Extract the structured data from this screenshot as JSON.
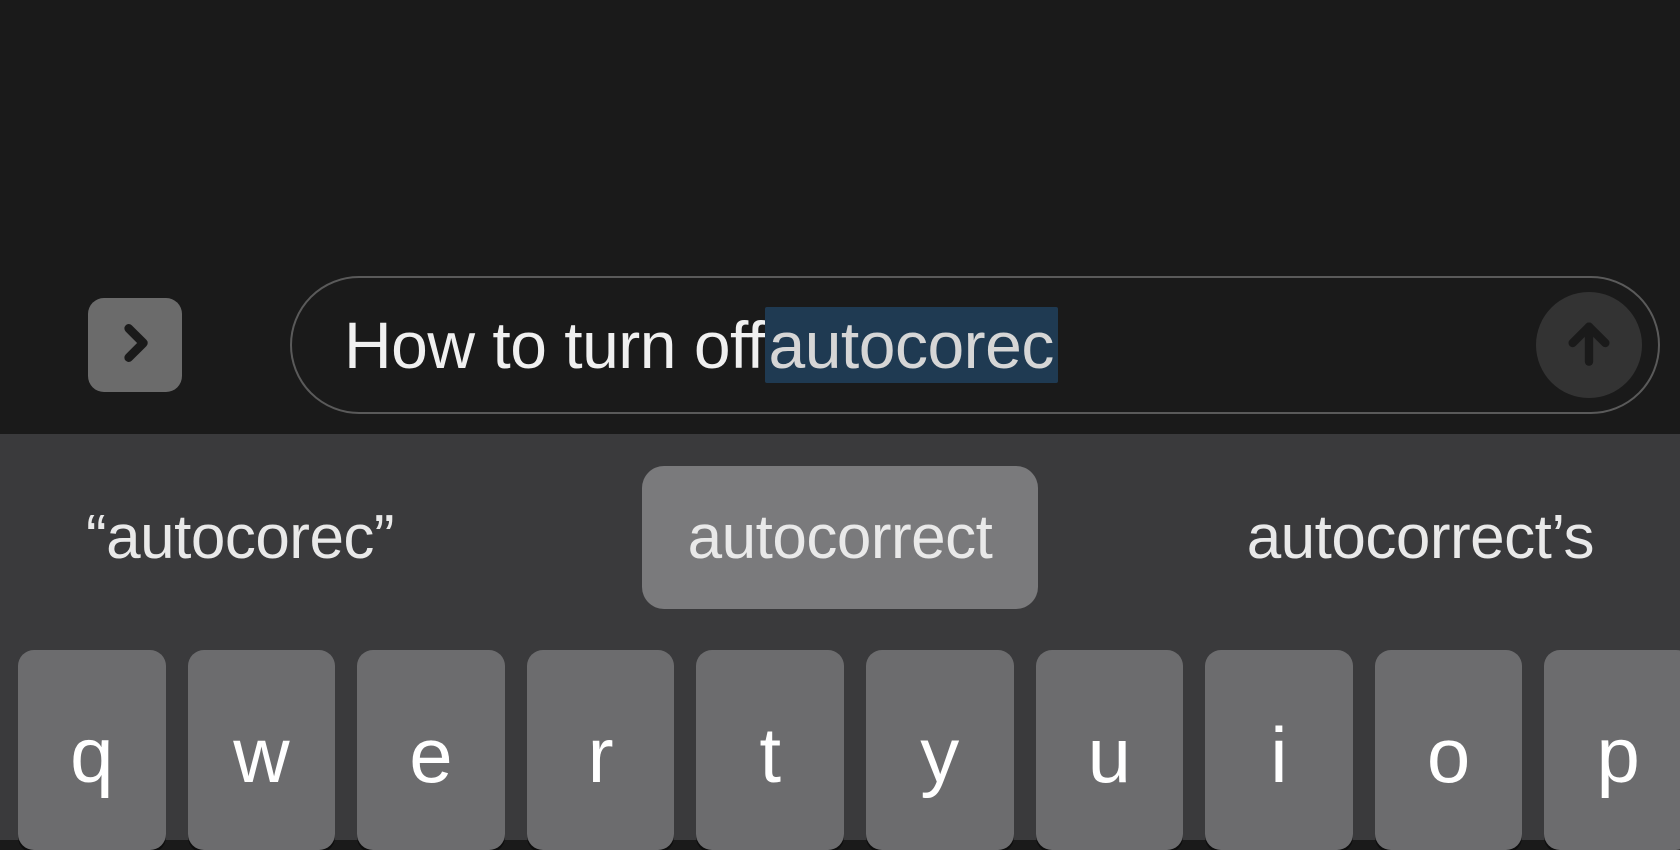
{
  "input": {
    "typed_text": "How to turn off ",
    "highlighted_suffix": "autocorec"
  },
  "suggestions": {
    "left": "“autocorec”",
    "center": "autocorrect",
    "right": "autocorrect’s"
  },
  "keyboard": {
    "row1": [
      "q",
      "w",
      "e",
      "r",
      "t",
      "y",
      "u",
      "i",
      "o",
      "p"
    ]
  }
}
